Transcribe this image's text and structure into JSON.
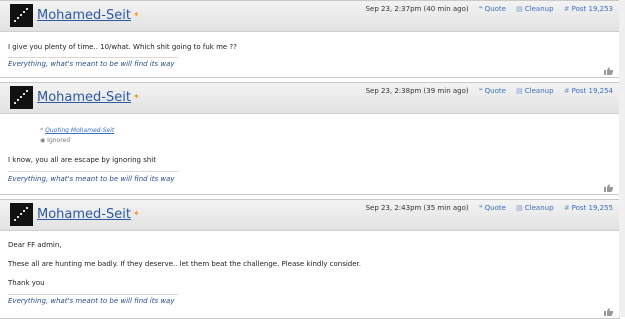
{
  "posts": [
    {
      "user": "Mohamed-Seit",
      "date": "Sep 23, 2:37pm (40 min ago)",
      "quote_label": "Quote",
      "cleanup_label": "Cleanup",
      "post_label": "Post 19,253",
      "lines": [
        "I give you plenty of time.. 10/what. Which shit going to fuk me ??"
      ],
      "signature": "Everything, what's meant to be will find its way"
    },
    {
      "user": "Mohamed-Seit",
      "date": "Sep 23, 2:38pm (39 min ago)",
      "quote_label": "Quote",
      "cleanup_label": "Cleanup",
      "post_label": "Post 19,254",
      "quoting": "Quoting Mohamed-Seit",
      "ignored": "Ignored",
      "lines": [
        "I know, you all are escape by ignoring shit"
      ],
      "signature": "Everything, what's meant to be will find its way"
    },
    {
      "user": "Mohamed-Seit",
      "date": "Sep 23, 2:43pm (35 min ago)",
      "quote_label": "Quote",
      "cleanup_label": "Cleanup",
      "post_label": "Post 19,255",
      "lines": [
        "Dear FF admin,",
        "These all are hunting me badly. If they deserve.. let them beat the challenge. Please kindly consider.",
        "Thank you"
      ],
      "signature": "Everything, what's meant to be will find its way"
    }
  ],
  "colors": {
    "link": "#3a6ec0",
    "username": "#2c5aa0",
    "star": "#f0a020"
  }
}
